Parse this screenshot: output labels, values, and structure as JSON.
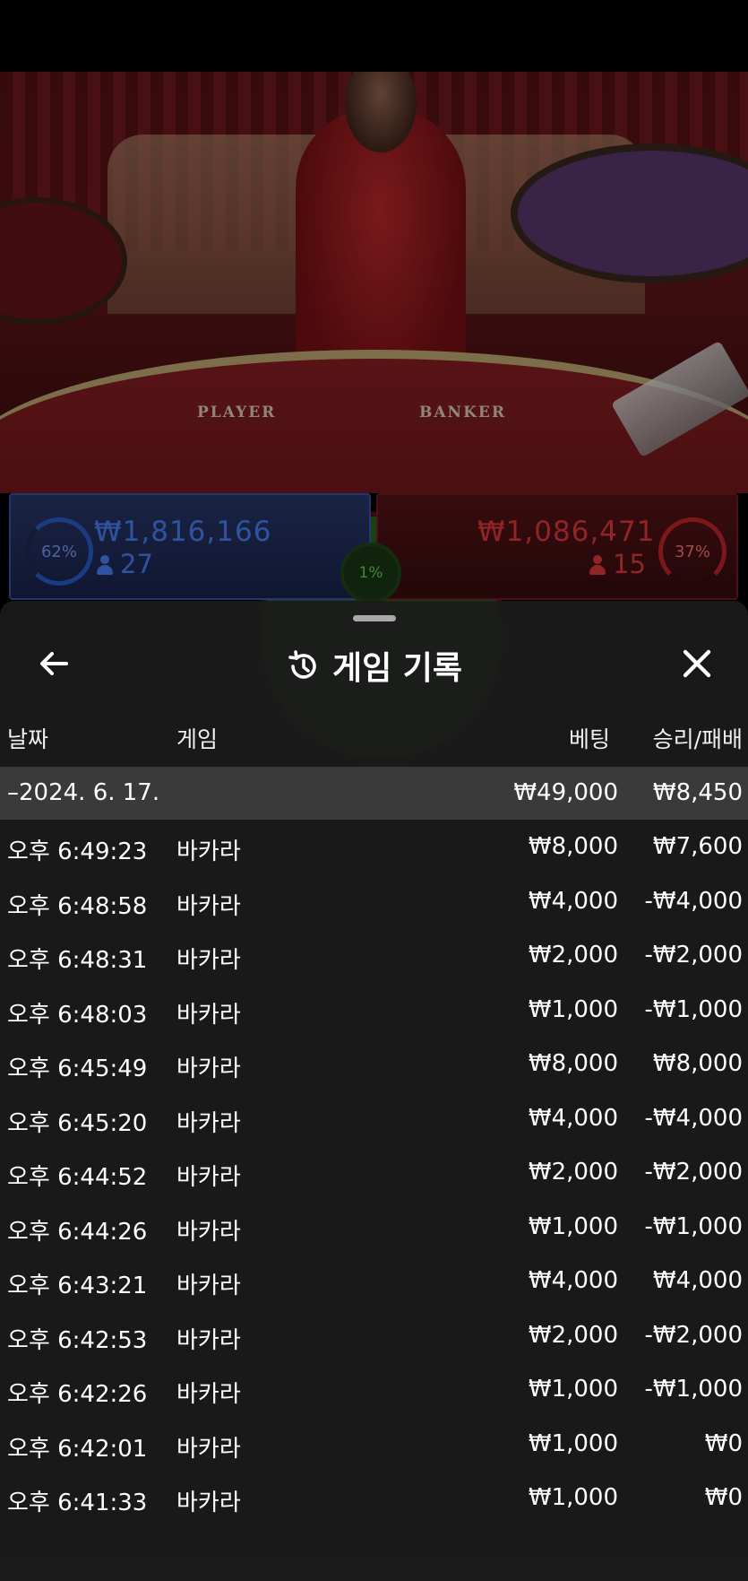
{
  "video": {
    "player_label": "PLAYER",
    "banker_label": "BANKER"
  },
  "betbar": {
    "player": {
      "percent": "62%",
      "amount": "₩1,816,166",
      "players": "27",
      "color": "#4d86ff"
    },
    "tie": {
      "percent": "1%",
      "color": "#6fd85a"
    },
    "banker": {
      "percent": "37%",
      "amount": "₩1,086,471",
      "players": "15",
      "color": "#e83a40"
    }
  },
  "history": {
    "title": "게임 기록",
    "icons": {
      "back": "arrow-left-icon",
      "title": "history-icon",
      "close": "close-x-icon"
    },
    "columns": {
      "date": "날짜",
      "game": "게임",
      "bet": "베팅",
      "win_loss": "승리/패배"
    },
    "date_group": {
      "date": "–2024. 6. 17.",
      "bet_total": "₩49,000",
      "win_loss_total": "₩8,450"
    },
    "rows": [
      {
        "time": "오후 6:49:23",
        "game": "바카라",
        "bet": "₩8,000",
        "result": "₩7,600"
      },
      {
        "time": "오후 6:48:58",
        "game": "바카라",
        "bet": "₩4,000",
        "result": "-₩4,000"
      },
      {
        "time": "오후 6:48:31",
        "game": "바카라",
        "bet": "₩2,000",
        "result": "-₩2,000"
      },
      {
        "time": "오후 6:48:03",
        "game": "바카라",
        "bet": "₩1,000",
        "result": "-₩1,000"
      },
      {
        "time": "오후 6:45:49",
        "game": "바카라",
        "bet": "₩8,000",
        "result": "₩8,000"
      },
      {
        "time": "오후 6:45:20",
        "game": "바카라",
        "bet": "₩4,000",
        "result": "-₩4,000"
      },
      {
        "time": "오후 6:44:52",
        "game": "바카라",
        "bet": "₩2,000",
        "result": "-₩2,000"
      },
      {
        "time": "오후 6:44:26",
        "game": "바카라",
        "bet": "₩1,000",
        "result": "-₩1,000"
      },
      {
        "time": "오후 6:43:21",
        "game": "바카라",
        "bet": "₩4,000",
        "result": "₩4,000"
      },
      {
        "time": "오후 6:42:53",
        "game": "바카라",
        "bet": "₩2,000",
        "result": "-₩2,000"
      },
      {
        "time": "오후 6:42:26",
        "game": "바카라",
        "bet": "₩1,000",
        "result": "-₩1,000"
      },
      {
        "time": "오후 6:42:01",
        "game": "바카라",
        "bet": "₩1,000",
        "result": "₩0"
      },
      {
        "time": "오후 6:41:33",
        "game": "바카라",
        "bet": "₩1,000",
        "result": "₩0"
      }
    ]
  }
}
